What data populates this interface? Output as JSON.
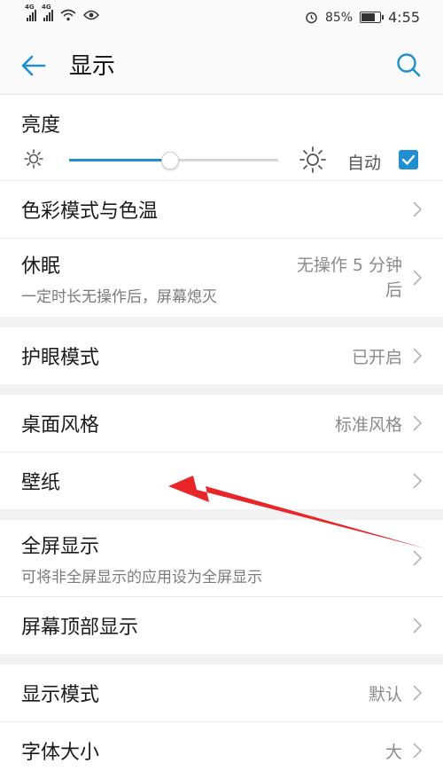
{
  "status": {
    "net1": "4G",
    "net2": "4G",
    "battery_percent": "85%",
    "battery_level": 0.85,
    "time": "4:55"
  },
  "appbar": {
    "title": "显示"
  },
  "brightness": {
    "label": "亮度",
    "level": 0.48,
    "auto_label": "自动",
    "auto_checked": true
  },
  "rows": {
    "color_mode": {
      "label": "色彩模式与色温"
    },
    "sleep": {
      "label": "休眠",
      "sub": "一定时长无操作后，屏幕熄灭",
      "value_line1": "无操作 5 分钟",
      "value_line2": "后"
    },
    "eye_care": {
      "label": "护眼模式",
      "value": "已开启"
    },
    "desktop_style": {
      "label": "桌面风格",
      "value": "标准风格"
    },
    "wallpaper": {
      "label": "壁纸"
    },
    "fullscreen": {
      "label": "全屏显示",
      "sub": "可将非全屏显示的应用设为全屏显示"
    },
    "top_display": {
      "label": "屏幕顶部显示"
    },
    "display_mode": {
      "label": "显示模式",
      "value": "默认"
    },
    "font_size": {
      "label": "字体大小",
      "value": "大"
    }
  },
  "colors": {
    "accent": "#1f8fd1",
    "annotation_arrow": "#e8262a"
  }
}
